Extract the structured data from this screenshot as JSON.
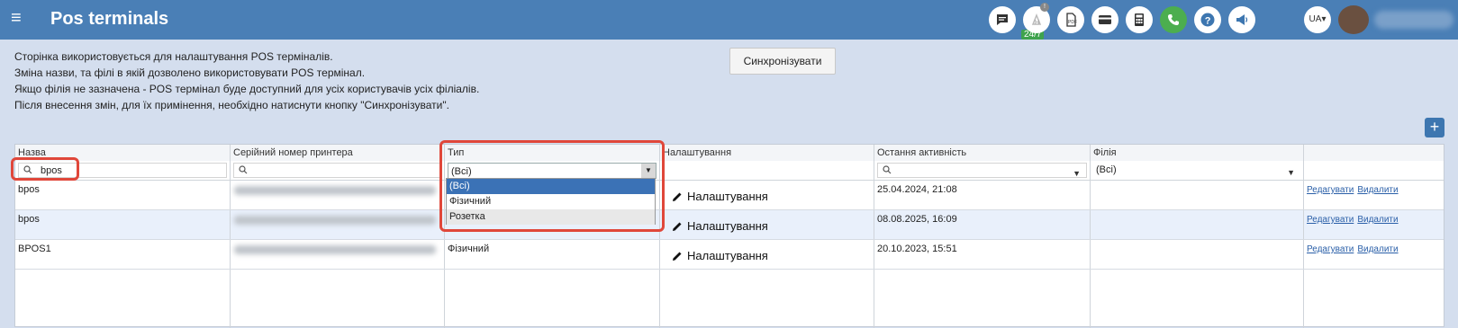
{
  "header": {
    "title": "Pos terminals",
    "menu_icon": "hamburger-icon",
    "support_badge": "24/7",
    "language": "UA",
    "chat_notification": "!"
  },
  "info_lines": [
    "Сторінка використовується для налаштування POS терміналів.",
    "Зміна назви, та філі в якій дозволено використовувати POS термінал.",
    "Якщо філія не зазначена - POS термінал буде доступний для усіх користувачів усіх філіалів.",
    "Після внесення змін, для їх примінення, необхідно натиснути кнопку \"Синхронізувати\"."
  ],
  "sync_button": "Синхронізувати",
  "add_button": "+",
  "columns": [
    "Назва",
    "Серійний номер принтера",
    "Тип",
    "Налаштування",
    "Остання активність",
    "Філія",
    ""
  ],
  "filters": {
    "name": "bpos",
    "type": "(Всі)",
    "branch": "(Всі)"
  },
  "type_options": [
    "(Всі)",
    "Фізичний",
    "Розетка"
  ],
  "rows": [
    {
      "name": "bpos",
      "type": "",
      "settings": "Налаштування",
      "last_activity": "25.04.2024, 21:08",
      "branch": "",
      "edit": "Редагувати",
      "delete": "Видалити"
    },
    {
      "name": "bpos",
      "type": "",
      "settings": "Налаштування",
      "last_activity": "08.08.2025, 16:09",
      "branch": "",
      "edit": "Редагувати",
      "delete": "Видалити"
    },
    {
      "name": "BPOS1",
      "type": "Фізичний",
      "settings": "Налаштування",
      "last_activity": "20.10.2023, 15:51",
      "branch": "",
      "edit": "Редагувати",
      "delete": "Видалити"
    }
  ],
  "colors": {
    "topbar": "#4a7fb6",
    "page_bg": "#d4deee",
    "highlight": "#e0473a",
    "selected_option": "#3b72b6",
    "link": "#2a5fa8"
  }
}
